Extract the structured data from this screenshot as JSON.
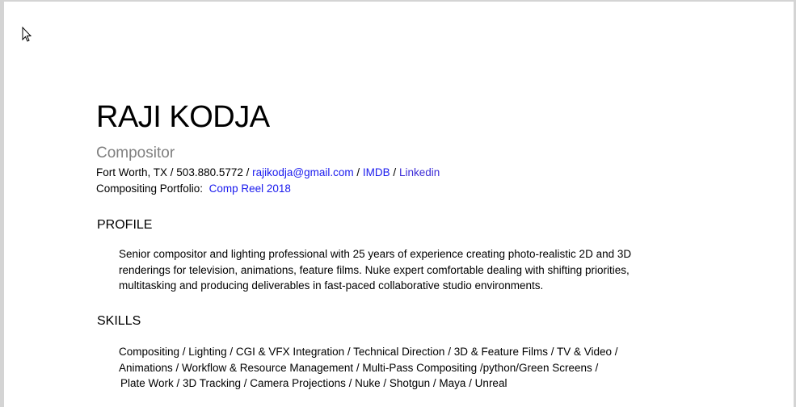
{
  "resume": {
    "name": "RAJI KODJA",
    "title": "Compositor",
    "contact": {
      "location": "Fort Worth,  TX",
      "sep": " / ",
      "phone": "503.880.5772",
      "email": "rajikodja@gmail.com",
      "imdb": "IMDB",
      "linkedin": "Linkedin"
    },
    "portfolio": {
      "label": "Compositing Portfolio:",
      "link": "Comp Reel 2018"
    },
    "profile": {
      "heading": "PROFILE",
      "lines": [
        "Senior compositor and lighting professional with 25 years of experience creating photo-realistic 2D and 3D",
        "renderings for television, animations, feature films. Nuke expert comfortable dealing with shifting priorities,",
        "multitasking and producing deliverables in fast-paced collaborative studio environments."
      ]
    },
    "skills": {
      "heading": "SKILLS",
      "lines": [
        "Compositing / Lighting / CGI & VFX Integration / Technical Direction / 3D & Feature Films / TV & Video /",
        "Animations / Workflow & Resource Management / Multi-Pass Compositing /python/Green Screens /",
        "Plate Work / 3D Tracking / Camera Projections / Nuke / Shotgun / Maya / Unreal"
      ]
    }
  },
  "colors": {
    "link": "#1a1aee",
    "title": "#808080"
  }
}
